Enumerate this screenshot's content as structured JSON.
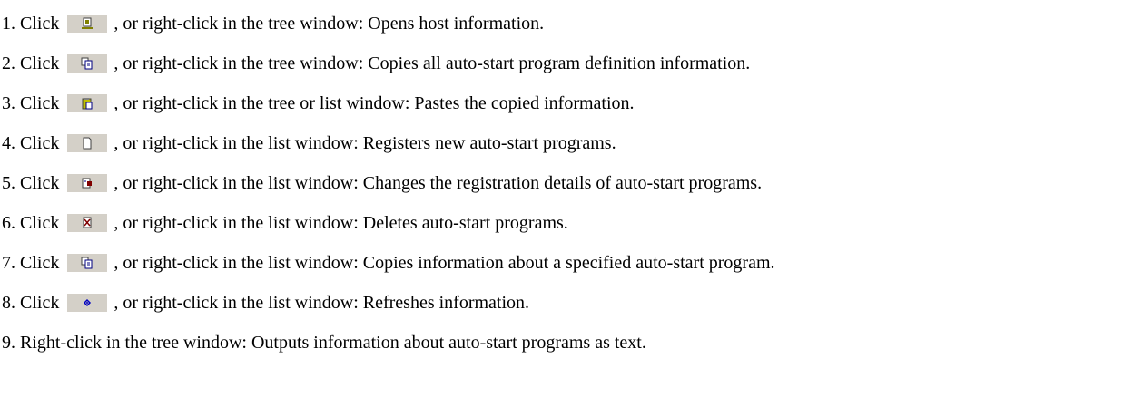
{
  "steps": [
    {
      "lead": "1. Click",
      "icon": "host-info-icon",
      "text": ", or right-click in the tree window: Opens host information."
    },
    {
      "lead": "2. Click",
      "icon": "copy-icon",
      "text": ", or right-click in the tree window: Copies all auto-start program definition information."
    },
    {
      "lead": "3. Click",
      "icon": "paste-icon",
      "text": ", or right-click in the tree or list window: Pastes the copied information."
    },
    {
      "lead": "4. Click",
      "icon": "new-document-icon",
      "text": ", or right-click in the list window: Registers new auto-start programs."
    },
    {
      "lead": "5. Click",
      "icon": "change-details-icon",
      "text": ", or right-click in the list window: Changes the registration details of auto-start programs."
    },
    {
      "lead": "6. Click",
      "icon": "delete-icon",
      "text": ", or right-click in the list window: Deletes auto-start programs."
    },
    {
      "lead": "7. Click",
      "icon": "copy-icon",
      "text": ", or right-click in the list window: Copies information about a specified auto-start program."
    },
    {
      "lead": "8. Click",
      "icon": "refresh-icon",
      "text": ", or right-click in the list window: Refreshes information."
    },
    {
      "lead": "",
      "icon": "",
      "text": "9. Right-click in the tree window: Outputs information about auto-start programs as text."
    }
  ],
  "colors": {
    "button_face": "#d4d0c8",
    "text": "#000000"
  }
}
